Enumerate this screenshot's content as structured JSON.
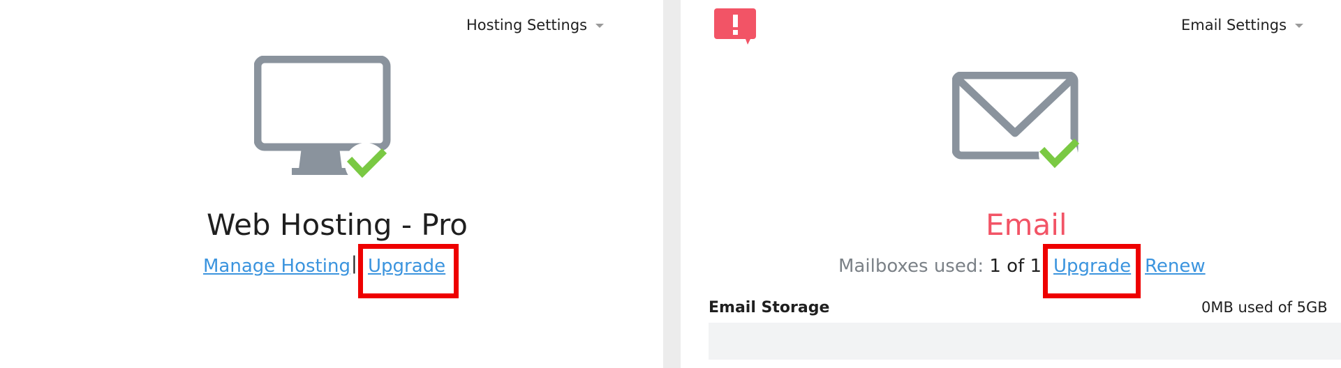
{
  "hosting": {
    "settings_label": "Hosting Settings",
    "icon": "monitor-check-icon",
    "title": "Web Hosting - Pro",
    "manage_link": "Manage Hosting",
    "separator": "|",
    "upgrade_link": "Upgrade"
  },
  "email": {
    "alert_icon": "alert-icon",
    "settings_label": "Email Settings",
    "icon": "envelope-check-icon",
    "title": "Email",
    "mailboxes_label": "Mailboxes used:",
    "mailboxes_value": "1 of 1",
    "upgrade_link": "Upgrade",
    "renew_link": "Renew",
    "storage_label": "Email Storage",
    "storage_usage": "0MB used of 5GB",
    "storage_fraction": 0
  },
  "colors": {
    "link": "#3b94de",
    "email_title": "#f25466",
    "alert": "#f25466",
    "check": "#7ac943",
    "icon_gray": "#8a939d",
    "highlight": "#ee0000"
  }
}
